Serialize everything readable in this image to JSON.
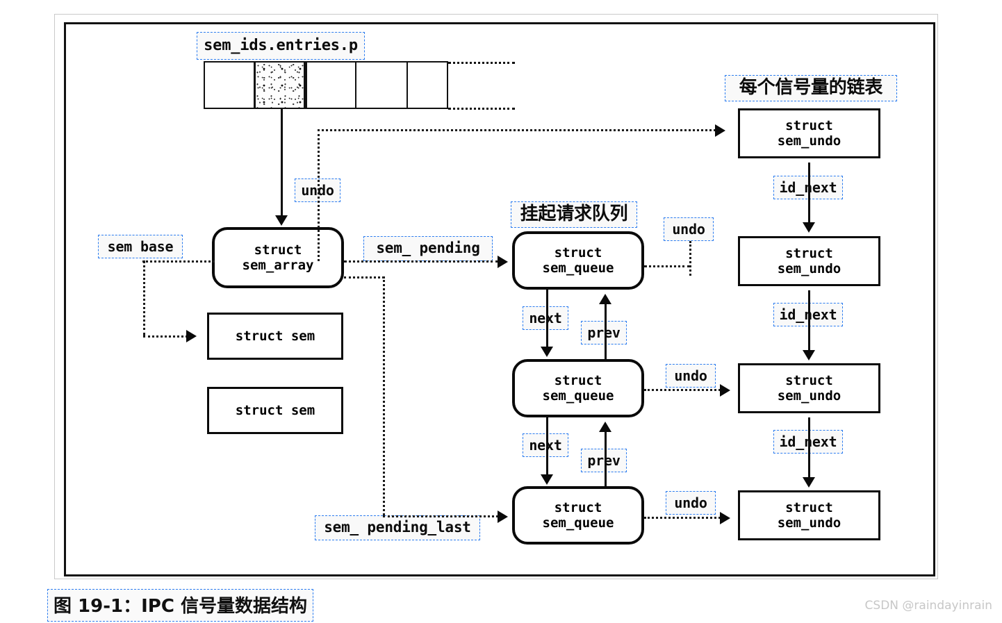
{
  "figure": {
    "caption": "图 19-1：IPC 信号量数据结构",
    "watermark": "CSDN @raindayinrain"
  },
  "headings": {
    "per_sem_list": "每个信号量的链表",
    "pending_queue": "挂起请求队列"
  },
  "array": {
    "label": "sem_ids.entries.p",
    "cells": [
      "",
      "",
      "",
      "",
      ""
    ],
    "shaded_cell_index": 1
  },
  "nodes": {
    "sem_array": {
      "line1": "struct",
      "line2": "sem_array"
    },
    "sem_1": {
      "line1": "struct sem"
    },
    "sem_2": {
      "line1": "struct sem"
    },
    "queue_1": {
      "line1": "struct",
      "line2": "sem_queue"
    },
    "queue_2": {
      "line1": "struct",
      "line2": "sem_queue"
    },
    "queue_3": {
      "line1": "struct",
      "line2": "sem_queue"
    },
    "undo_1": {
      "line1": "struct",
      "line2": "sem_undo"
    },
    "undo_2": {
      "line1": "struct",
      "line2": "sem_undo"
    },
    "undo_3": {
      "line1": "struct",
      "line2": "sem_undo"
    },
    "undo_4": {
      "line1": "struct",
      "line2": "sem_undo"
    }
  },
  "edges": {
    "undo_from_array": "undo",
    "sem_base": "sem base",
    "sem_pending": "sem_ pending",
    "sem_pending_last": "sem_ pending_last",
    "undo_q1": "undo",
    "undo_q2": "undo",
    "undo_q3": "undo",
    "next_1": "next",
    "next_2": "next",
    "prev_1": "prev",
    "prev_2": "prev",
    "id_next_1": "id_next",
    "id_next_2": "id_next",
    "id_next_3": "id_next"
  },
  "colors": {
    "ocr_box": "#2b7cf0",
    "ink": "#0a0a0a",
    "frame": "#111111",
    "watermark": "#c7c7c7"
  }
}
